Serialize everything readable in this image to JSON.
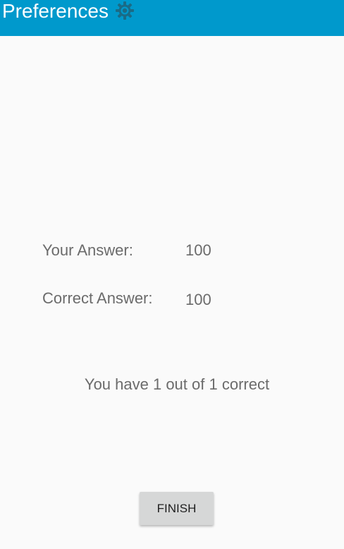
{
  "app_bar": {
    "title": "Preferences",
    "icon": "gear-icon",
    "background_color": "#0099cc",
    "icon_color": "#1a6b86"
  },
  "results": {
    "your_answer_label": "Your Answer:",
    "your_answer_value": "100",
    "correct_answer_label": "Correct Answer:",
    "correct_answer_value": "100",
    "score_text": "You have 1 out of 1 correct"
  },
  "actions": {
    "finish_label": "FINISH"
  }
}
